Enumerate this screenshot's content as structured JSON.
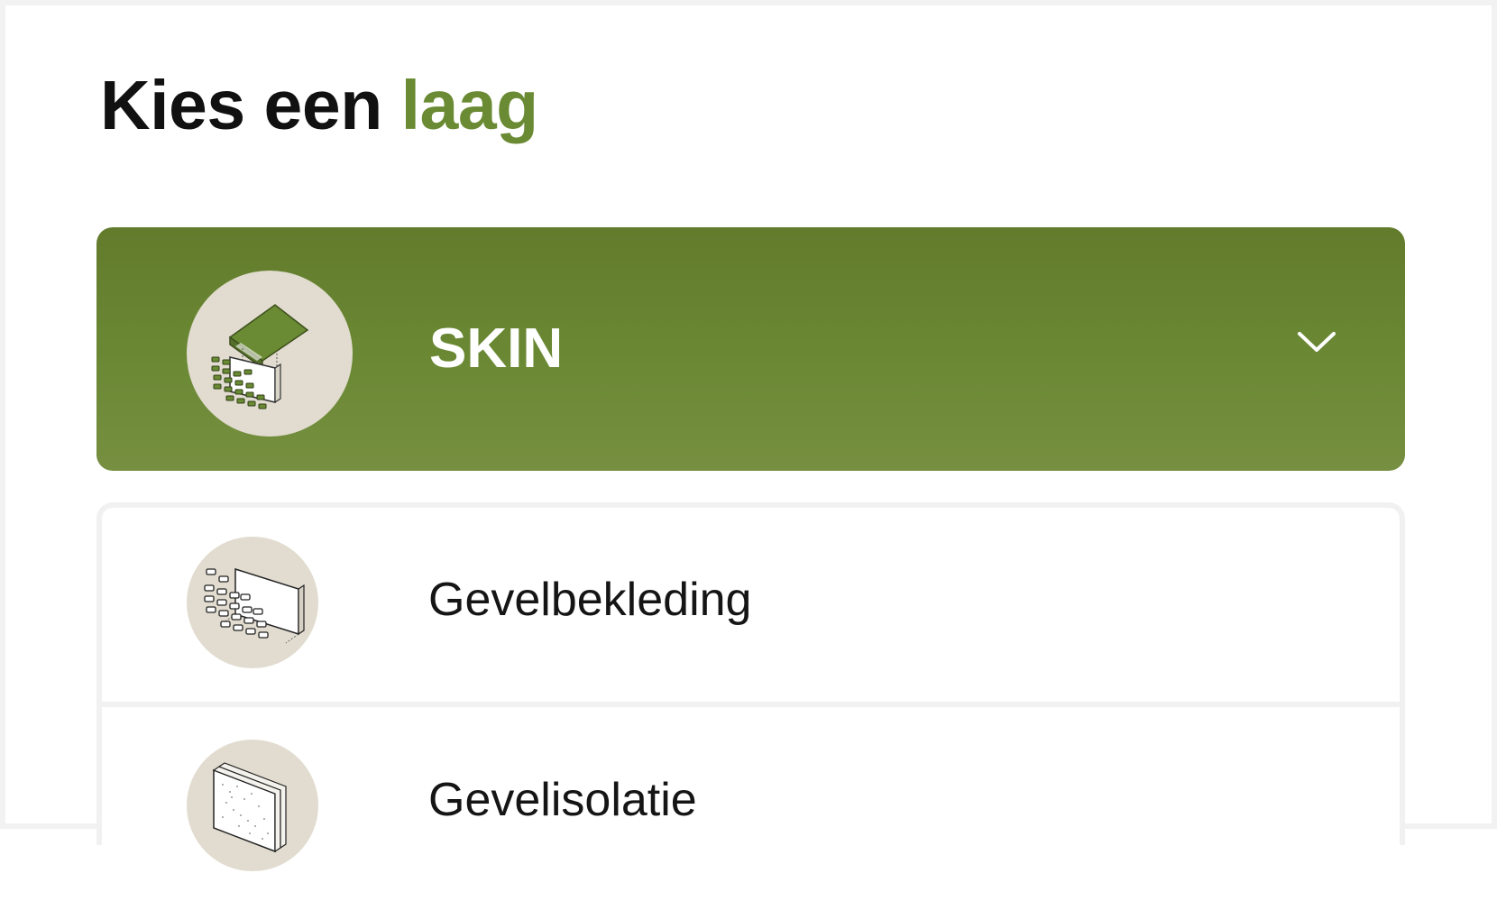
{
  "header": {
    "title_part1": "Kies een",
    "title_part2": "laag"
  },
  "layers": {
    "selected": {
      "label": "SKIN",
      "icon": "roof-and-wall-icon",
      "expand_icon": "chevron-down-icon"
    },
    "items": [
      {
        "label": "Gevelbekleding",
        "icon": "brick-facade-icon"
      },
      {
        "label": "Gevelisolatie",
        "icon": "insulation-panel-icon"
      }
    ]
  },
  "colors": {
    "accent": "#6a8a33",
    "card_green_top": "#627b2c",
    "card_green_bottom": "#768f40",
    "icon_circle": "#e1dccf",
    "border": "#f1f1f1"
  }
}
